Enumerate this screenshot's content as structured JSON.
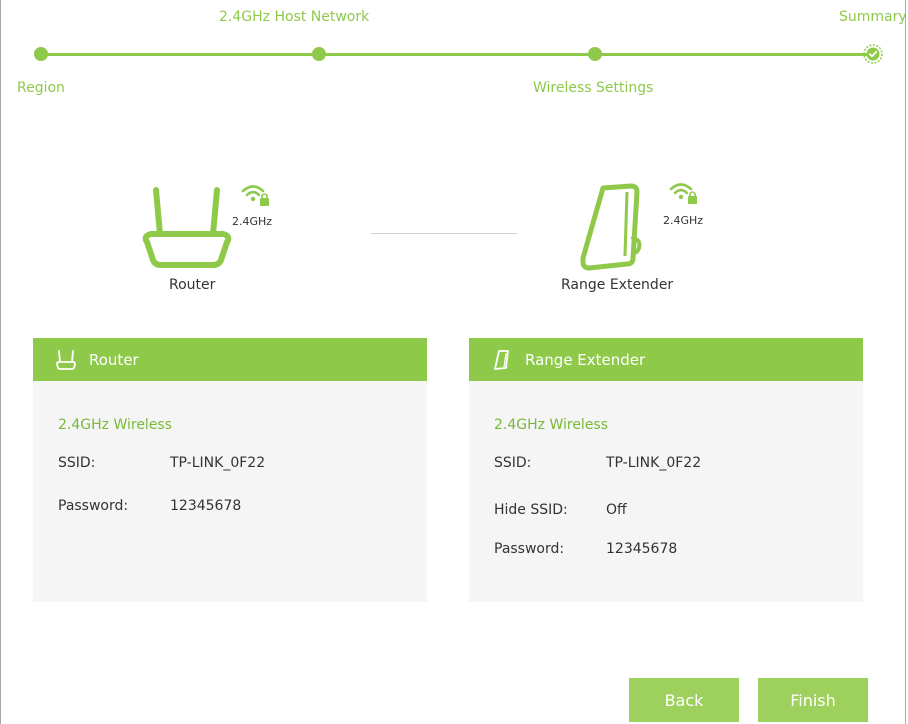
{
  "progress": {
    "steps": [
      {
        "label": "Region"
      },
      {
        "label": "2.4GHz Host Network"
      },
      {
        "label": "Wireless Settings"
      },
      {
        "label": "Summary"
      }
    ]
  },
  "diagram": {
    "router_label": "Router",
    "router_band": "2.4GHz",
    "extender_label": "Range Extender",
    "extender_band": "2.4GHz"
  },
  "router_panel": {
    "title": "Router",
    "section_title": "2.4GHz Wireless",
    "ssid_label": "SSID:",
    "ssid_value": "TP-LINK_0F22",
    "password_label": "Password:",
    "password_value": "12345678"
  },
  "extender_panel": {
    "title": "Range Extender",
    "section_title": "2.4GHz Wireless",
    "ssid_label": "SSID:",
    "ssid_value": "TP-LINK_0F22",
    "hide_ssid_label": "Hide SSID:",
    "hide_ssid_value": "Off",
    "password_label": "Password:",
    "password_value": "12345678"
  },
  "buttons": {
    "back": "Back",
    "finish": "Finish"
  },
  "colors": {
    "accent": "#8fc94a",
    "button": "#9dd05c",
    "panel_bg": "#f5f5f5"
  },
  "icons": {
    "router": "router-icon",
    "extender": "range-extender-icon",
    "wifi_lock": "wifi-lock-icon",
    "check": "check-circle-icon"
  }
}
